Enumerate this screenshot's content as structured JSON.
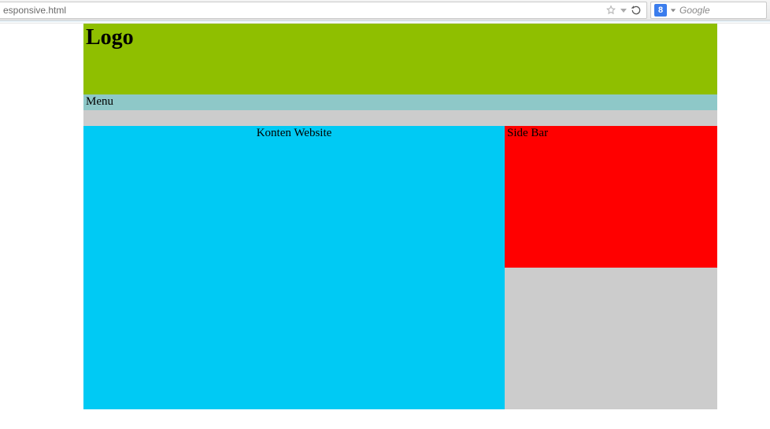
{
  "browser": {
    "url_fragment": "esponsive.html",
    "search_engine_badge": "8",
    "search_placeholder": "Google"
  },
  "page": {
    "header": {
      "logo": "Logo"
    },
    "menu": {
      "label": "Menu"
    },
    "content": {
      "title": "Konten Website"
    },
    "sidebar": {
      "title": "Side Bar"
    }
  },
  "colors": {
    "header_bg": "#8fbf00",
    "menu_bg": "#8ec8c8",
    "wrapper_bg": "#cccccc",
    "content_bg": "#00caf4",
    "sidebar_bg": "#ff0000"
  }
}
